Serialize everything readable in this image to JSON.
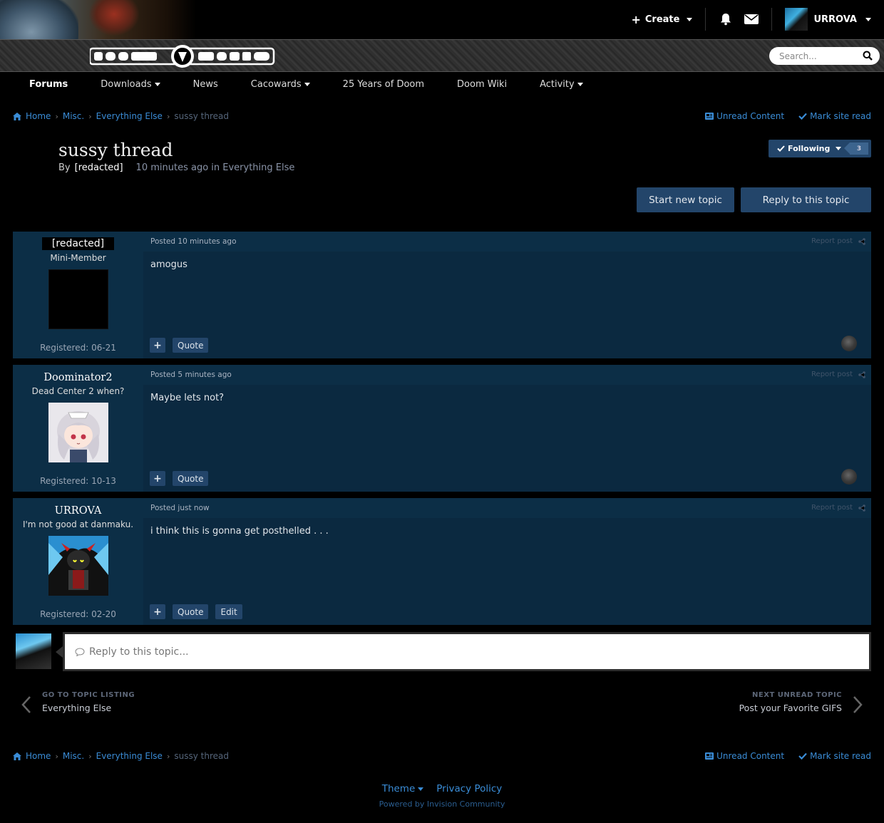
{
  "header": {
    "create_label": "Create",
    "username": "URROVA",
    "search_placeholder": "Search..."
  },
  "nav": {
    "forums": "Forums",
    "downloads": "Downloads",
    "news": "News",
    "cacowards": "Cacowards",
    "years": "25 Years of Doom",
    "wiki": "Doom Wiki",
    "activity": "Activity"
  },
  "breadcrumb": {
    "home": "Home",
    "misc": "Misc.",
    "everything_else": "Everything Else",
    "current": "sussy thread",
    "unread": "Unread Content",
    "mark_read": "Mark site read"
  },
  "topic": {
    "title": "sussy thread",
    "by_label": "By",
    "author": "[redacted]",
    "meta": "10 minutes ago in Everything Else",
    "following_label": "Following",
    "follower_count": "3",
    "start_new": "Start new topic",
    "reply": "Reply to this topic"
  },
  "posts": [
    {
      "author": "[redacted]",
      "title": "Mini-Member",
      "registered": "Registered: 06-21",
      "posted": "Posted 10 minutes ago",
      "report": "Report post",
      "content": "amogus",
      "quote": "Quote"
    },
    {
      "author": "Doominator2",
      "title": "Dead Center 2 when?",
      "registered": "Registered: 10-13",
      "posted": "Posted 5 minutes ago",
      "report": "Report post",
      "content": "Maybe lets not?",
      "quote": "Quote"
    },
    {
      "author": "URROVA",
      "title": "I'm not good at danmaku.",
      "registered": "Registered: 02-20",
      "posted": "Posted just now",
      "report": "Report post",
      "content": "i think this is gonna get posthelled . . .",
      "quote": "Quote",
      "edit": "Edit"
    }
  ],
  "reply_box": {
    "placeholder": "Reply to this topic..."
  },
  "topic_nav": {
    "prev_small": "GO TO TOPIC LISTING",
    "prev_link": "Everything Else",
    "next_small": "NEXT UNREAD TOPIC",
    "next_link": "Post your Favorite GIFS"
  },
  "footer": {
    "theme": "Theme",
    "privacy": "Privacy Policy",
    "powered": "Powered by Invision Community"
  },
  "colors": {
    "accent": "#23456a",
    "link": "#3a8cd6",
    "post_bg": "#0a2c45"
  }
}
